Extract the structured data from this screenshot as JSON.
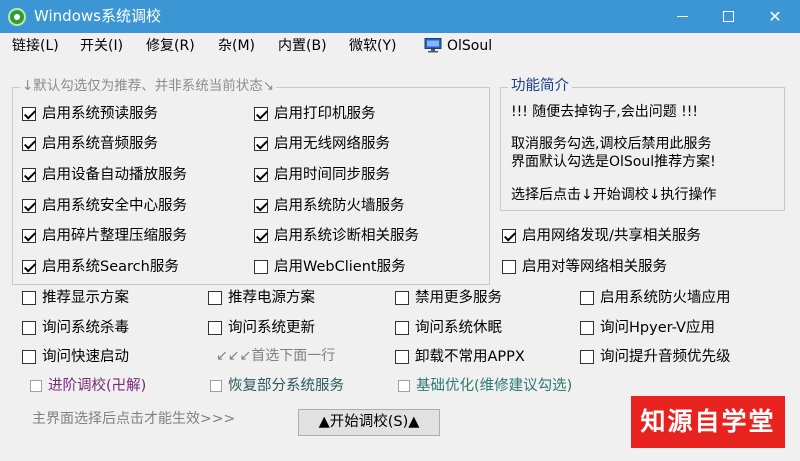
{
  "window": {
    "title": "Windows系统调校",
    "minimize": "—",
    "close": "✕"
  },
  "menu": [
    {
      "label": "链接(L)"
    },
    {
      "label": "开关(I)"
    },
    {
      "label": "修复(R)"
    },
    {
      "label": "杂(M)"
    },
    {
      "label": "内置(B)"
    },
    {
      "label": "微软(Y)"
    },
    {
      "label": "OlSoul",
      "icon": "computer-icon"
    }
  ],
  "group": {
    "legend": "↓默认勾选仅为推荐、并非系统当前状态↘"
  },
  "intro": {
    "title": "功能简介",
    "lines": [
      "!!! 随便去掉钩子,会出问题 !!!",
      "取消服务勾选,调校后禁用此服务",
      "界面默认勾选是OlSoul推荐方案!",
      "选择后点击↓开始调校↓执行操作"
    ]
  },
  "services": [
    {
      "label": "启用系统预读服务",
      "checked": true
    },
    {
      "label": "启用打印机服务",
      "checked": true
    },
    {
      "label": "启用系统音频服务",
      "checked": true
    },
    {
      "label": "启用无线网络服务",
      "checked": true
    },
    {
      "label": "启用设备自动播放服务",
      "checked": true
    },
    {
      "label": "启用时间同步服务",
      "checked": true
    },
    {
      "label": "启用系统安全中心服务",
      "checked": true
    },
    {
      "label": "启用系统防火墙服务",
      "checked": true
    },
    {
      "label": "启用碎片整理压缩服务",
      "checked": true
    },
    {
      "label": "启用系统诊断相关服务",
      "checked": true
    },
    {
      "label": "启用网络发现/共享相关服务",
      "checked": true
    },
    {
      "label": "启用系统Search服务",
      "checked": true
    },
    {
      "label": "启用WebClient服务",
      "checked": false
    },
    {
      "label": "启用对等网络相关服务",
      "checked": false
    }
  ],
  "options": [
    {
      "label": "推荐显示方案",
      "checked": false
    },
    {
      "label": "推荐电源方案",
      "checked": false
    },
    {
      "label": "禁用更多服务",
      "checked": false
    },
    {
      "label": "启用系统防火墙应用",
      "checked": false
    },
    {
      "label": "询问系统杀毒",
      "checked": false
    },
    {
      "label": "询问系统更新",
      "checked": false
    },
    {
      "label": "询问系统休眠",
      "checked": false
    },
    {
      "label": "询问Hpyer-V应用",
      "checked": false
    },
    {
      "label": "询问快速启动",
      "checked": false
    },
    {
      "label": "卸载不常用APPX",
      "checked": false
    },
    {
      "label": "询问提升音频优先级",
      "checked": false
    }
  ],
  "first_hint": "↙↙↙首选下面一行",
  "modes": [
    {
      "label": "进阶调校(卍解)",
      "checked": false,
      "color": "#7a2a7a"
    },
    {
      "label": "恢复部分系统服务",
      "checked": false,
      "color": "#2d5a5a"
    },
    {
      "label": "基础优化(维修建议勾选)",
      "checked": false,
      "color": "#2d7a70"
    }
  ],
  "apply_note": "主界面选择后点击才能生效>>>",
  "start_button": "▲开始调校(S)▲",
  "watermark": "知源自学堂"
}
